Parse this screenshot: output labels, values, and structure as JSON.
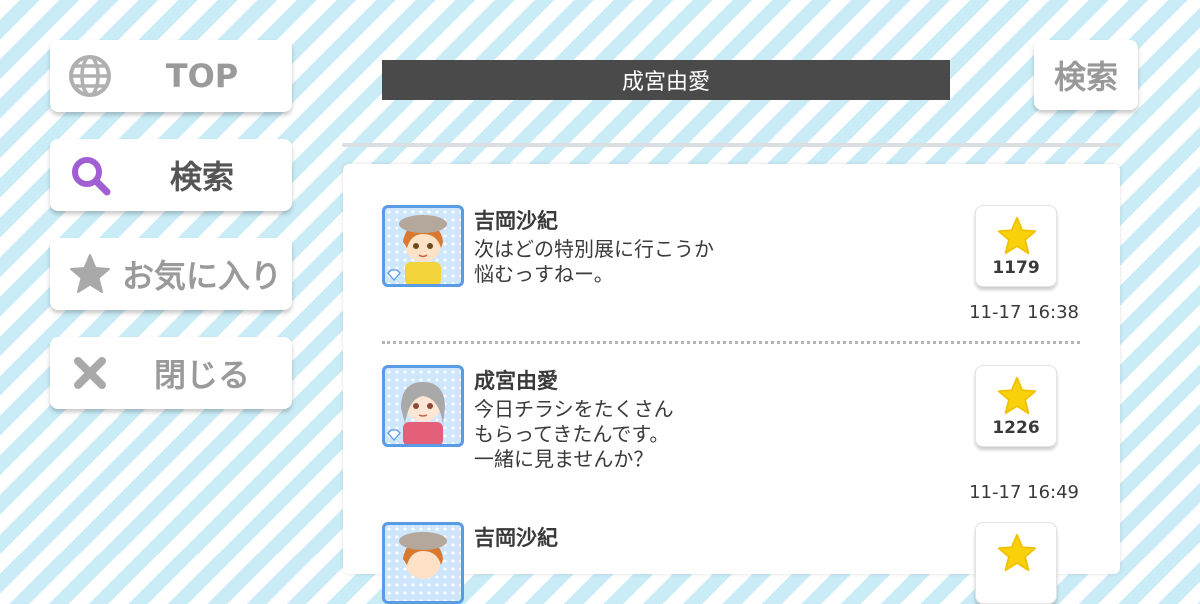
{
  "nav": {
    "top_label": "TOP",
    "search_label": "検索",
    "favorites_label": "お気に入り",
    "close_label": "閉じる"
  },
  "header": {
    "title": "成宮由愛",
    "search_button": "検索"
  },
  "posts": [
    {
      "author": "吉岡沙紀",
      "message": "次はどの特別展に行こうか\n悩むっすねー。",
      "likes": "1179",
      "time": "11-17 16:38"
    },
    {
      "author": "成宮由愛",
      "message": "今日チラシをたくさん\nもらってきたんです。\n一緒に見ませんか？",
      "likes": "1226",
      "time": "11-17 16:49"
    },
    {
      "author": "吉岡沙紀",
      "message": "",
      "likes": "",
      "time": ""
    }
  ],
  "colors": {
    "accent_purple": "#a25fd3",
    "star_yellow": "#f9d10a",
    "title_bar": "#4a4a4a",
    "avatar_border": "#5a9be6"
  }
}
